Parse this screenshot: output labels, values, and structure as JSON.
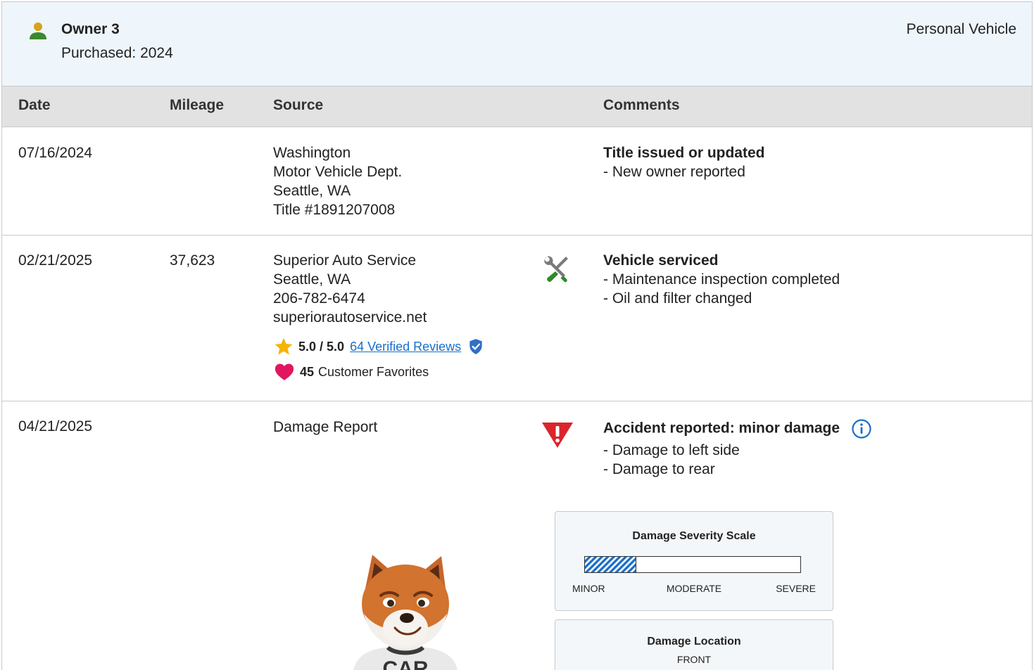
{
  "owner": {
    "title": "Owner 3",
    "purchased": "Purchased: 2024",
    "vehicle_type": "Personal Vehicle"
  },
  "columns": {
    "date": "Date",
    "mileage": "Mileage",
    "source": "Source",
    "comments": "Comments"
  },
  "records": [
    {
      "date": "07/16/2024",
      "mileage": "",
      "source": [
        "Washington",
        "Motor Vehicle Dept.",
        "Seattle, WA",
        "Title #1891207008"
      ],
      "comment_title": "Title issued or updated",
      "comment_lines": [
        "- New owner reported"
      ]
    },
    {
      "date": "02/21/2025",
      "mileage": "37,623",
      "source": [
        "Superior Auto Service",
        "Seattle, WA",
        "206-782-6474",
        "superiorautoservice.net"
      ],
      "icon": "wrench-screwdriver-icon",
      "rating": "5.0 / 5.0",
      "reviews_link": "64 Verified Reviews",
      "favorites_count": "45",
      "favorites_label": "Customer Favorites",
      "comment_title": "Vehicle serviced",
      "comment_lines": [
        "- Maintenance inspection completed",
        "- Oil and filter changed"
      ]
    },
    {
      "date": "04/21/2025",
      "mileage": "",
      "source": [
        "Damage Report"
      ],
      "icon": "warning-triangle-icon",
      "comment_title": "Accident reported: minor damage",
      "comment_lines": [
        "- Damage to left side",
        "- Damage to rear"
      ]
    }
  ],
  "severity": {
    "title": "Damage Severity Scale",
    "level_fraction": 0.24,
    "labels": [
      "MINOR",
      "MODERATE",
      "SEVERE"
    ]
  },
  "location": {
    "title": "Damage Location",
    "front_label": "FRONT"
  },
  "colors": {
    "accent": "#1a6fc9",
    "owner_icon_body": "#3a8a2e",
    "owner_icon_head": "#d9a21b",
    "star": "#f5b400",
    "heart": "#e0165f",
    "warning": "#d9252b",
    "header_bg": "#eef5fb"
  }
}
